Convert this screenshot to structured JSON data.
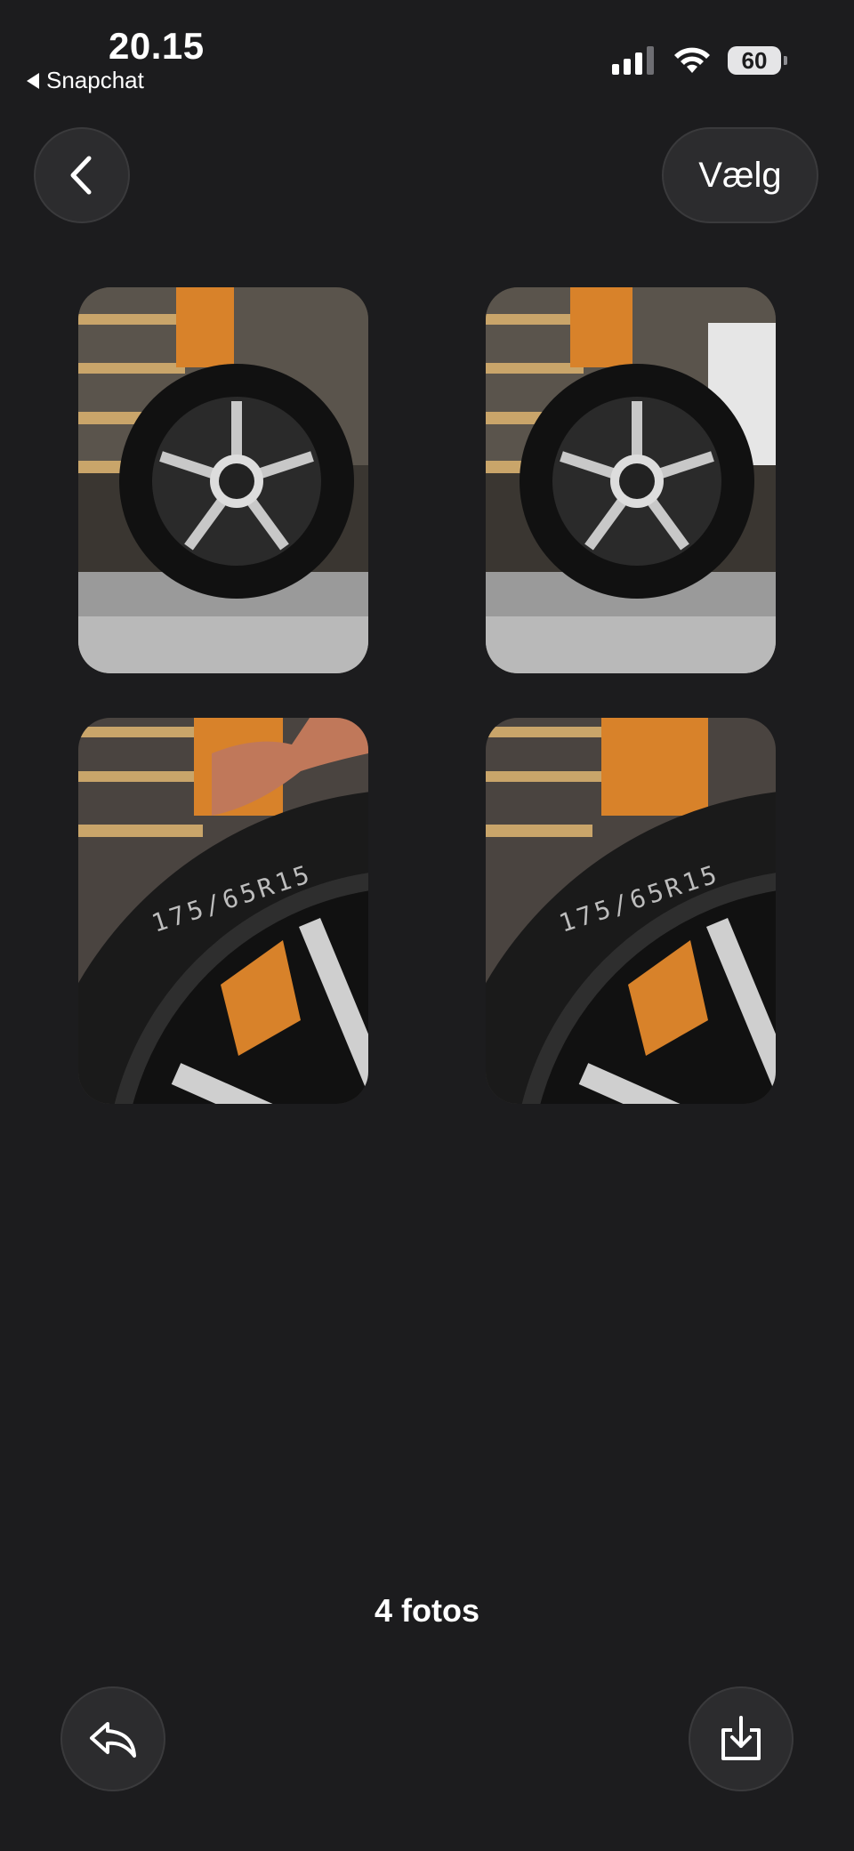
{
  "status_bar": {
    "time": "20.15",
    "back_app": "Snapchat",
    "battery": "60"
  },
  "header": {
    "select_label": "Vælg"
  },
  "gallery": {
    "count_label": "4 fotos",
    "photos": [
      {
        "subject": "wheel-front"
      },
      {
        "subject": "wheel-front"
      },
      {
        "subject": "tire-closeup"
      },
      {
        "subject": "tire-closeup"
      }
    ],
    "tire_text": "175/65R15"
  },
  "icons": {
    "back": "chevron-left-icon",
    "reply": "reply-icon",
    "save": "download-icon"
  },
  "colors": {
    "background": "#1c1c1e",
    "button": "#2c2c2e",
    "wood": "#d8822a"
  }
}
